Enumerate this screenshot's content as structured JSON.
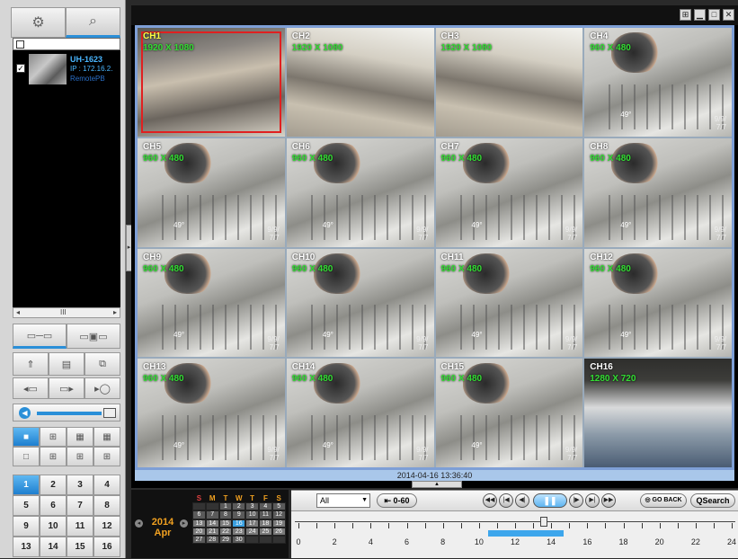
{
  "device": {
    "name": "UH-1623",
    "ip": "IP : 172.16.2.",
    "sub": "RemotePB"
  },
  "scroll_label": "III",
  "volume": {
    "level": 0.8
  },
  "layout_buttons": [
    "",
    "",
    "",
    "",
    "",
    "",
    "",
    ""
  ],
  "channel_numbers": [
    "1",
    "2",
    "3",
    "4",
    "5",
    "6",
    "7",
    "8",
    "9",
    "10",
    "11",
    "12",
    "13",
    "14",
    "15",
    "16"
  ],
  "cameras": [
    {
      "label": "CH1",
      "res": "1920 X 1080"
    },
    {
      "label": "CH2",
      "res": "1920 X 1080"
    },
    {
      "label": "CH3",
      "res": "1920 X 1080"
    },
    {
      "label": "CH4",
      "res": "960 X 480"
    },
    {
      "label": "CH5",
      "res": "960 X 480"
    },
    {
      "label": "CH6",
      "res": "960 X 480"
    },
    {
      "label": "CH7",
      "res": "960 X 480"
    },
    {
      "label": "CH8",
      "res": "960 X 480"
    },
    {
      "label": "CH9",
      "res": "960 X 480"
    },
    {
      "label": "CH10",
      "res": "960 X 480"
    },
    {
      "label": "CH11",
      "res": "960 X 480"
    },
    {
      "label": "CH12",
      "res": "960 X 480"
    },
    {
      "label": "CH13",
      "res": "960 X 480"
    },
    {
      "label": "CH14",
      "res": "960 X 480"
    },
    {
      "label": "CH15",
      "res": "960 X 480"
    },
    {
      "label": "CH16",
      "res": "1280 X 720"
    }
  ],
  "timestamp": "2014-04-16 13:36:40",
  "calendar": {
    "year": "2014",
    "month": "Apr",
    "day_headers": [
      "S",
      "M",
      "T",
      "W",
      "T",
      "F",
      "S"
    ],
    "days": [
      "",
      "",
      "1",
      "2",
      "3",
      "4",
      "5",
      "6",
      "7",
      "8",
      "9",
      "10",
      "11",
      "12",
      "13",
      "14",
      "15",
      "16",
      "17",
      "18",
      "19",
      "20",
      "21",
      "22",
      "23",
      "24",
      "25",
      "26",
      "27",
      "28",
      "29",
      "30",
      "",
      "",
      ""
    ],
    "today": "16"
  },
  "playback": {
    "channel_select": "All",
    "range_label": "0-60",
    "go_back": "GO BACK",
    "qsearch": "QSearch",
    "timeline_labels": [
      "0",
      "2",
      "4",
      "6",
      "8",
      "10",
      "12",
      "14",
      "16",
      "18",
      "20",
      "22",
      "24"
    ],
    "recorded_range": [
      10.5,
      14.7
    ],
    "cursor_hour": 13.6
  }
}
